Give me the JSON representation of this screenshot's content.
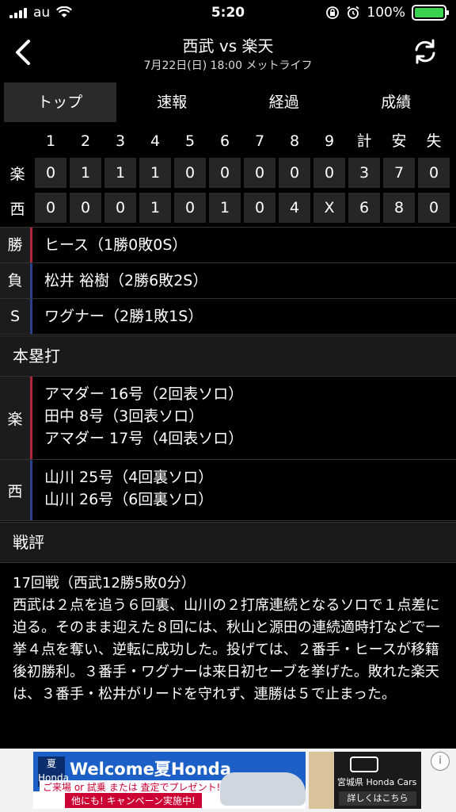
{
  "status_bar": {
    "carrier": "au",
    "time": "5:20",
    "battery": "100%"
  },
  "header": {
    "title": "西武 vs 楽天",
    "subtitle": "7月22日(日) 18:00 メットライフ"
  },
  "tabs": [
    "トップ",
    "速報",
    "経過",
    "成績"
  ],
  "scoreboard": {
    "columns": [
      "1",
      "2",
      "3",
      "4",
      "5",
      "6",
      "7",
      "8",
      "9",
      "計",
      "安",
      "失"
    ],
    "rows": [
      {
        "team": "楽",
        "values": [
          "0",
          "1",
          "1",
          "1",
          "0",
          "0",
          "0",
          "0",
          "0",
          "3",
          "7",
          "0"
        ]
      },
      {
        "team": "西",
        "values": [
          "0",
          "0",
          "0",
          "1",
          "0",
          "1",
          "0",
          "4",
          "X",
          "6",
          "8",
          "0"
        ]
      }
    ]
  },
  "pitchers": [
    {
      "label": "勝",
      "text": "ヒース（1勝0敗0S）",
      "color": "#b3263c"
    },
    {
      "label": "負",
      "text": "松井 裕樹（2勝6敗2S）",
      "color": "#2a3f8f"
    },
    {
      "label": "S",
      "text": "ワグナー（2勝1敗1S）",
      "color": "#2a3f8f"
    }
  ],
  "home_runs": {
    "title": "本塁打",
    "teams": [
      {
        "label": "楽",
        "color": "#b3263c",
        "lines": [
          "アマダー 16号（2回表ソロ）",
          "田中 8号（3回表ソロ）",
          "アマダー 17号（4回表ソロ）"
        ]
      },
      {
        "label": "西",
        "color": "#2a3f8f",
        "lines": [
          "山川 25号（4回裏ソロ）",
          "山川 26号（6回裏ソロ）"
        ]
      }
    ]
  },
  "review": {
    "title": "戦評",
    "heading": "17回戦（西武12勝5敗0分）",
    "body": "西武は２点を追う６回裏、山川の２打席連続となるソロで１点差に迫る。そのまま迎えた８回には、秋山と源田の連続適時打などで一挙４点を奪い、逆転に成功した。投げては、２番手・ヒースが移籍後初勝利。３番手・ワグナーは来日初セーブを挙げた。敗れた楽天は、３番手・松井がリードを守れず、連勝は５で止まった。"
  },
  "ad": {
    "badge": "夏 Honda",
    "headline": "Welcome夏Honda",
    "line2": "ご来場 or 試乗 または 査定でプレゼント!",
    "line3": "他にも! キャンペーン実施中!",
    "brand": "宮城県 Honda Cars",
    "cta": "詳しくはこちら"
  }
}
